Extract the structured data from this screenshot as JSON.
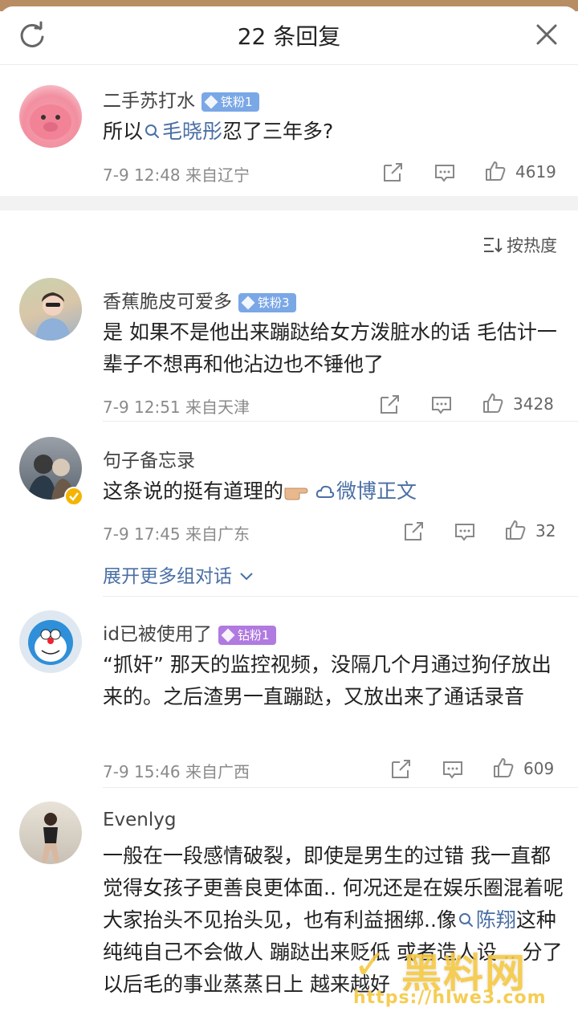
{
  "header": {
    "title": "22 条回复"
  },
  "top_comment": {
    "username": "二手苏打水",
    "badge": "铁粉1",
    "text_before": "所以",
    "topic": "毛晓彤",
    "text_after": "忍了三年多?",
    "time": "7-9 12:48",
    "location": "来自辽宁",
    "likes": "4619"
  },
  "sort_label": "按热度",
  "replies": [
    {
      "username": "香蕉脆皮可爱多",
      "badge": "铁粉3",
      "text": "是 如果不是他出来蹦跶给女方泼脏水的话 毛估计一辈子不想再和他沾边也不锤他了",
      "time": "7-9 12:51",
      "location": "来自天津",
      "likes": "3428"
    },
    {
      "username": "句子备忘录",
      "text": "这条说的挺有道理的",
      "link": "微博正文",
      "time": "7-9 17:45",
      "location": "来自广东",
      "likes": "32",
      "expand": "展开更多组对话"
    },
    {
      "username": "id已被使用了",
      "badge": "钻粉1",
      "text": "“抓奸” 那天的监控视频，没隔几个月通过狗仔放出来的。之后渣男一直蹦跶，又放出来了通话录音",
      "time": "7-9 15:46",
      "location": "来自广西",
      "likes": "609"
    },
    {
      "username": "Evenlyg",
      "text_before": "一般在一段感情破裂，即使是男生的过错 我一直都觉得女孩子更善良更体面.. 何况还是在娱乐圈混着呢 大家抬头不见抬头见，也有利益捆绑..像",
      "topic": "陈翔",
      "text_after": "这种纯纯自己不会做人 蹦跶出来贬低 或者造人设 .. 分了以后毛的事业蒸蒸日上 越来越好"
    }
  ],
  "watermark": {
    "name": "黑料网",
    "url": "https://hlwe3.com"
  },
  "colors": {
    "link": "#4a6fa5",
    "iron_badge": "#7aa7e6",
    "diamond_badge": "#b07ae0",
    "verified": "#f5b400"
  }
}
